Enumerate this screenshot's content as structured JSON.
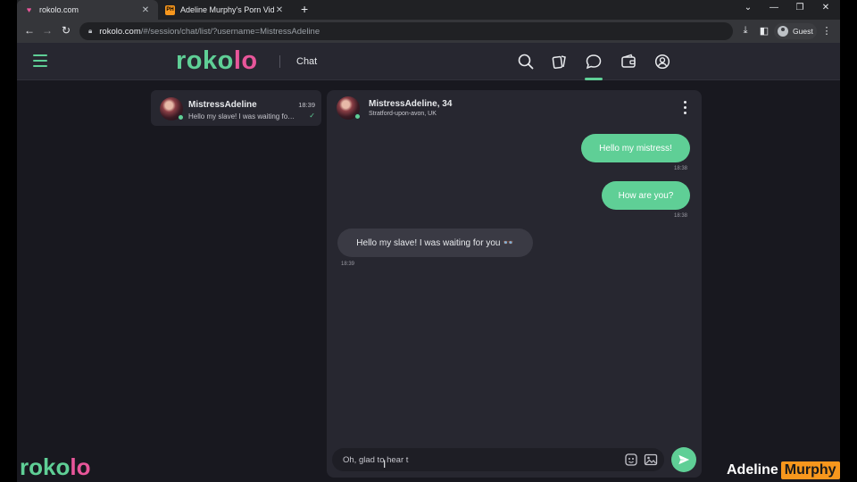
{
  "browser": {
    "tabs": [
      {
        "title": "rokolo.com",
        "active": true,
        "favicon": "heart-icon"
      },
      {
        "title": "Adeline Murphy's Porn Videos | P",
        "active": false,
        "favicon": "ph-icon"
      }
    ],
    "url_host": "rokolo.com",
    "url_path": "/#/session/chat/list/?username=MistressAdeline",
    "profile_label": "Guest"
  },
  "app": {
    "logo_a": "roko",
    "logo_b": "lo",
    "page_title": "Chat",
    "accent": "#5fcf96",
    "brand_pink": "#e8569a"
  },
  "conversation_list": [
    {
      "name": "MistressAdeline",
      "time": "18:39",
      "preview": "Hello my slave! I was waiting for you",
      "status": "read"
    }
  ],
  "chat": {
    "header_name": "MistressAdeline, 34",
    "header_location": "Stratford-upon-avon, UK",
    "messages": [
      {
        "text": "Hello my mistress!",
        "time": "18:38",
        "direction": "out"
      },
      {
        "text": "How are you?",
        "time": "18:38",
        "direction": "out"
      },
      {
        "text": "Hello my slave! I was waiting for you 👓",
        "time": "18:39",
        "direction": "in"
      }
    ],
    "input_value": "Oh, glad to hear t"
  },
  "watermark": {
    "logo_a": "roko",
    "logo_b": "lo",
    "brand_a": "Adeline",
    "brand_b": "Murphy"
  }
}
